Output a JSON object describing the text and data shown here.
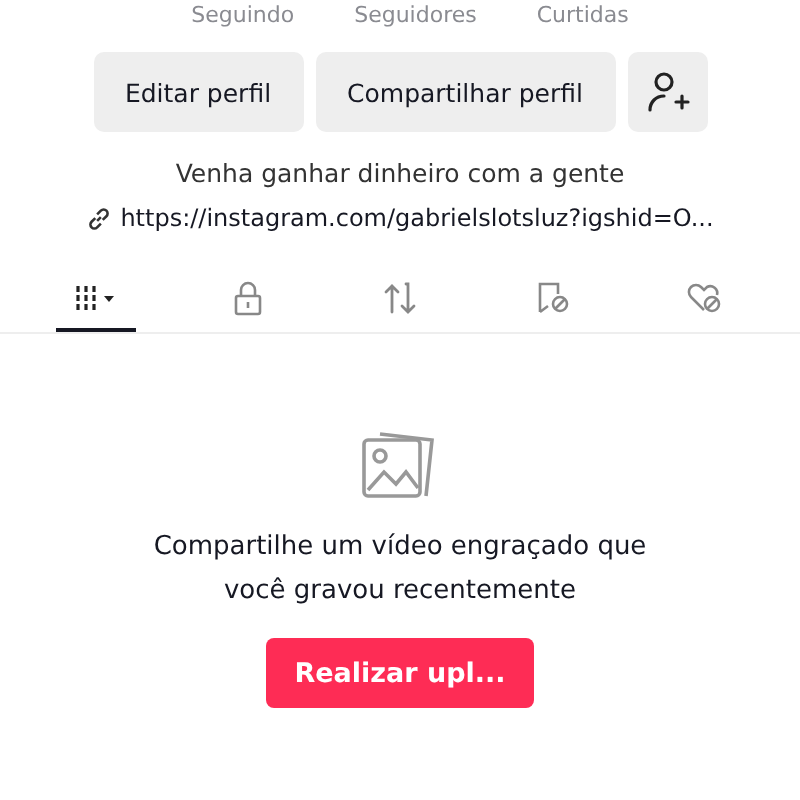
{
  "stats": [
    {
      "label": "Seguindo"
    },
    {
      "label": "Seguidores"
    },
    {
      "label": "Curtidas"
    }
  ],
  "actions": [
    {
      "kind": "text",
      "label": "Editar perfil"
    },
    {
      "kind": "text",
      "label": "Compartilhar perfil"
    },
    {
      "kind": "add-friend"
    }
  ],
  "bio": "Venha ganhar dinheiro com a gente",
  "link": "https://instagram.com/gabrielslotsluz?igshid=O...",
  "tabs": [
    {
      "kind": "videos",
      "selected": true
    },
    {
      "kind": "private",
      "selected": false
    },
    {
      "kind": "reposts",
      "selected": false
    },
    {
      "kind": "favorites",
      "selected": false
    },
    {
      "kind": "liked",
      "selected": false
    }
  ],
  "empty": {
    "message": "Compartilhe um vídeo engraçado que você gravou recentemente",
    "button": "Realizar upl..."
  }
}
